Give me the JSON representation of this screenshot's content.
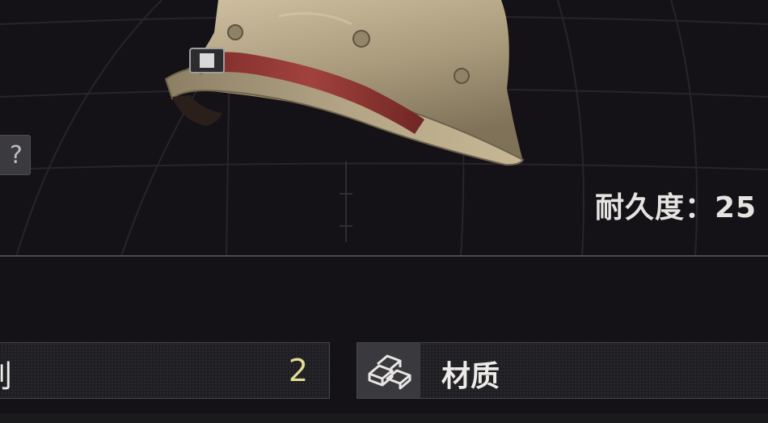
{
  "item": {
    "name": "helmet",
    "icon": "helmet-icon"
  },
  "help": {
    "label": "?"
  },
  "durability": {
    "text": "耐久度：25"
  },
  "stats": {
    "left": {
      "label": "别",
      "value": "2"
    },
    "material": {
      "icon": "ingot-stack-icon",
      "label": "材质"
    }
  },
  "colors": {
    "background": "#141216",
    "value_yellow": "#e3dc95",
    "helmet_khaki": "#b8a888",
    "strap_red": "#9a3a36"
  }
}
